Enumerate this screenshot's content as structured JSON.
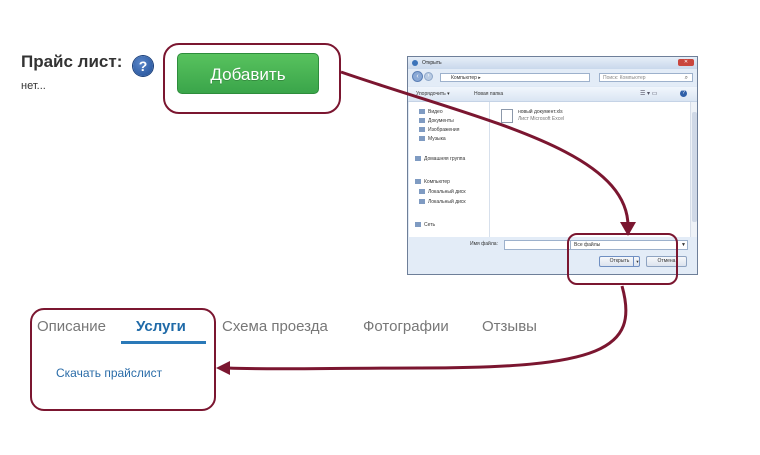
{
  "price_list": {
    "label": "Прайс лист:",
    "help_glyph": "?",
    "value": "нет...",
    "add_button_label": "Добавить"
  },
  "dialog": {
    "title": "Открыть",
    "path": "Компьютер ▸",
    "search_placeholder": "Поиск: Компьютер",
    "organize_label": "Упорядочить ▾",
    "new_folder_label": "Новая папка",
    "nav_items": [
      "Видео",
      "Документы",
      "Изображения",
      "Музыка",
      "Домашняя группа",
      "Компьютер",
      "Локальный диск",
      "Локальный диск",
      "Сеть"
    ],
    "file_name": "новый документ.xls",
    "file_meta": "Лист Microsoft Excel",
    "filename_label": "Имя файла:",
    "filter_value": "Все файлы",
    "open_button": "Открыть",
    "cancel_button": "Отмена",
    "close_glyph": "✕"
  },
  "tabs": {
    "items": [
      "Описание",
      "Услуги",
      "Схема проезда",
      "Фотографии",
      "Отзывы"
    ],
    "active": "Услуги"
  },
  "services": {
    "download_link": "Скачать прайслист"
  },
  "colors": {
    "annotation": "#7b1630",
    "add_button": "#44b04f",
    "tab_active": "#2a79b8",
    "link": "#2a6ca8"
  }
}
